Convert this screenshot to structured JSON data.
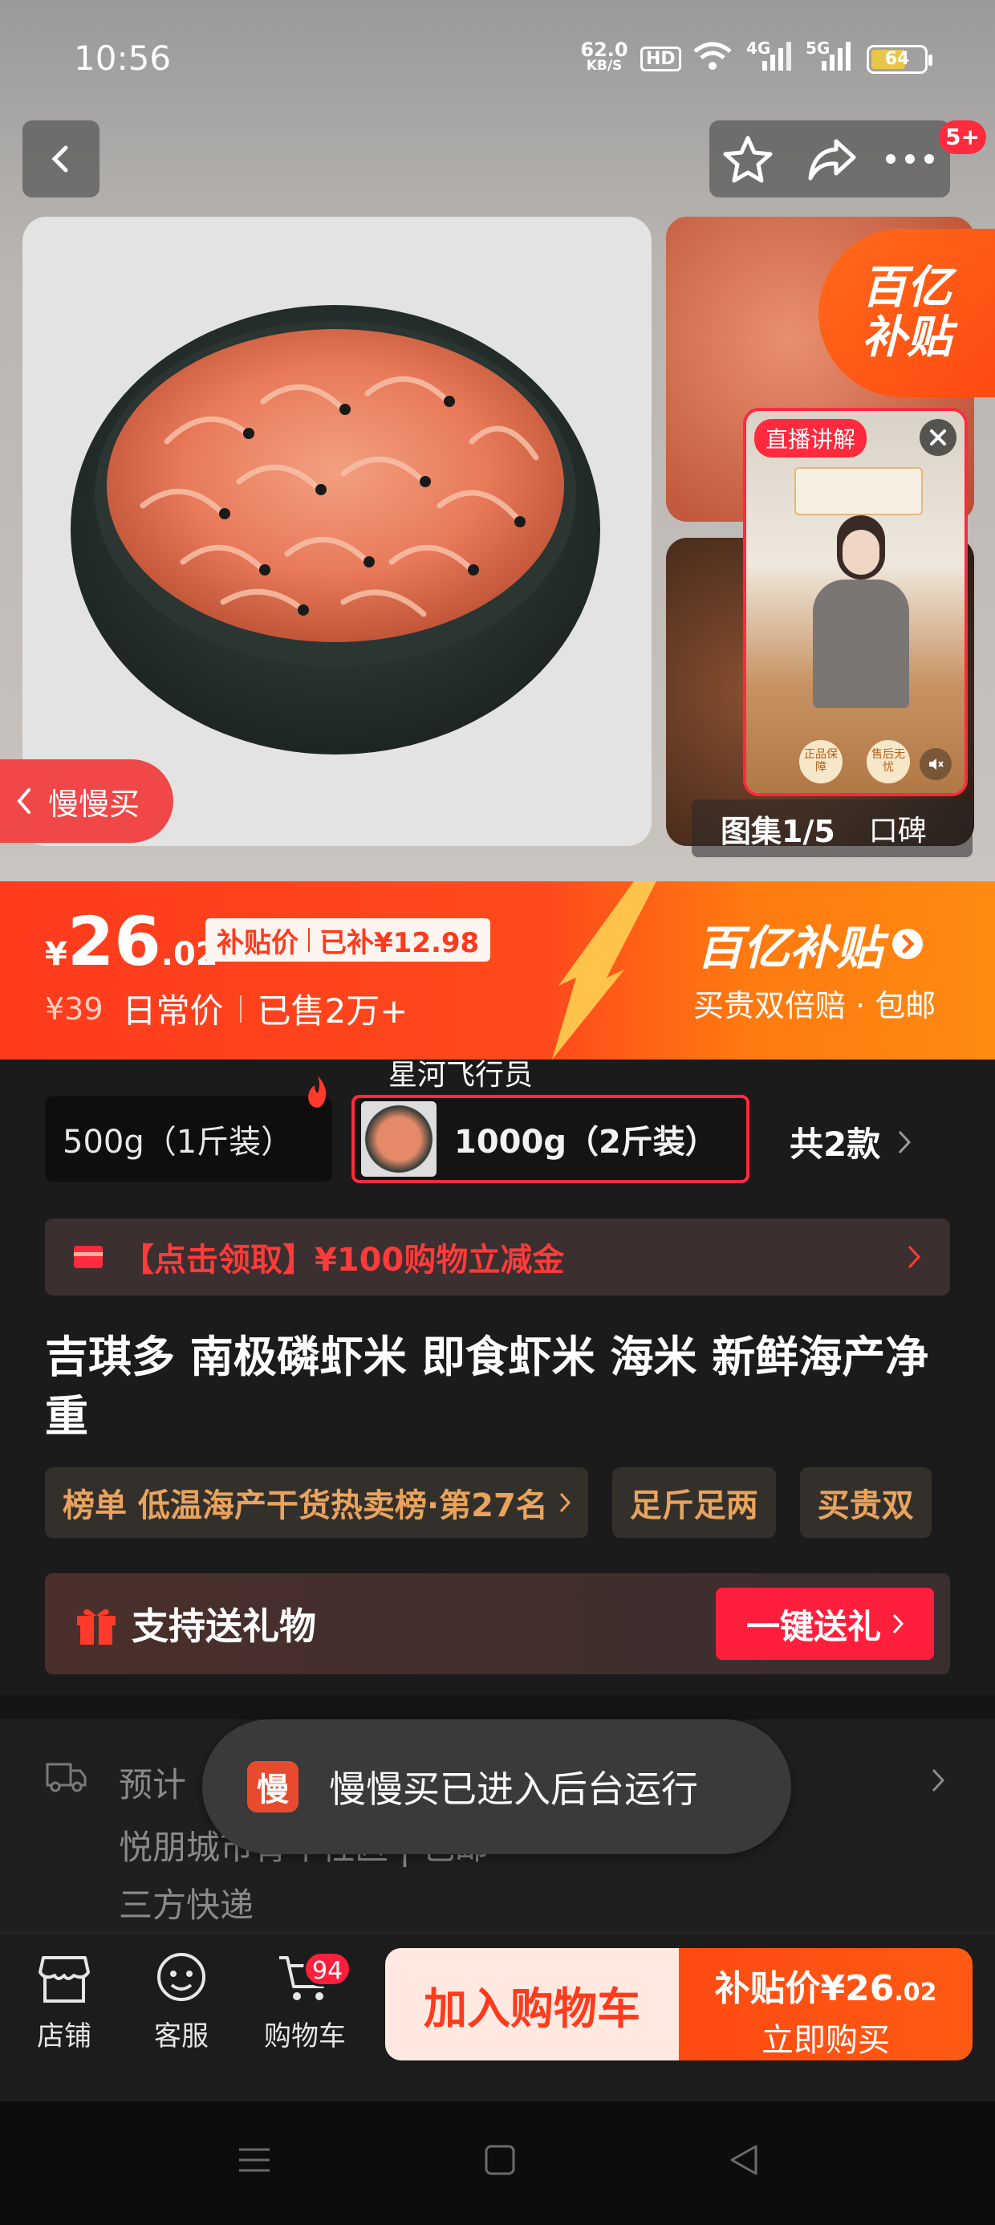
{
  "status_bar": {
    "time": "10:56",
    "net_speed_value": "62.0",
    "net_speed_unit": "KB/S",
    "hd_badge": "HD",
    "signal1_label": "4G",
    "signal2_label": "5G",
    "battery": "64"
  },
  "header": {
    "back_icon": "chevron-left-icon",
    "notif_badge": "5+"
  },
  "gallery": {
    "subsidy_badge_line1": "百亿",
    "subsidy_badge_line2": "补贴",
    "live_label": "直播讲解",
    "live_card_badge1": "正品保障",
    "live_card_badge2": "售后无忧",
    "counter": "图集1/5",
    "reviews_tab": "口碑",
    "slow_buy_label": "慢慢买"
  },
  "price": {
    "currency": "¥",
    "integer": "26",
    "decimal": ".02",
    "tag_left": "补贴价",
    "tag_right": "已补¥12.98",
    "original": "¥39",
    "original_label": "日常价",
    "sold": "已售2万+",
    "subsidy_title": "百亿补贴",
    "subsidy_sub": "买贵双倍赔 · 包邮"
  },
  "sku": {
    "floating_username": "星河飞行员",
    "option1": "500g（1斤装）",
    "option2": "1000g（2斤装）",
    "total": "共2款"
  },
  "coupon": {
    "text": "【点击领取】¥100购物立减金"
  },
  "product": {
    "title": "吉琪多 南极磷虾米 即食虾米 海米 新鲜海产净重",
    "tags": [
      "榜单 低温海产干货热卖榜·第27名",
      "足斤足两",
      "买贵双"
    ]
  },
  "gift": {
    "label": "支持送礼物",
    "button": "一键送礼"
  },
  "shipping": {
    "line1_prefix": "预计",
    "line2": "悦朋城市青年社区 | 包邮",
    "line3": "三方快递"
  },
  "toast": {
    "icon_char": "慢",
    "text": "慢慢买已进入后台运行"
  },
  "bottom_bar": {
    "store": "店铺",
    "service": "客服",
    "cart": "购物车",
    "cart_badge": "94",
    "add_cart": "加入购物车",
    "buy_price_label": "补贴价¥26",
    "buy_price_decimal": ".02",
    "buy_now": "立即购买"
  },
  "colors": {
    "accent_red": "#ff1f3d",
    "price_orange": "#ff4a1c",
    "tag_text": "#e9a35d"
  }
}
